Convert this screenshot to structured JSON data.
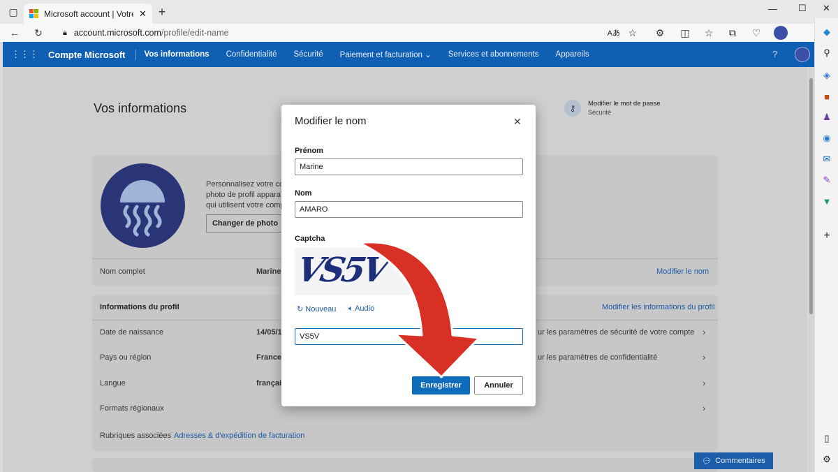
{
  "browser": {
    "tab_title": "Microsoft account | Votre profil",
    "url_host": "account.microsoft.com",
    "url_path": "/profile/edit-name"
  },
  "header": {
    "brand": "Compte Microsoft",
    "nav": [
      "Vos informations",
      "Confidentialité",
      "Sécurité",
      "Paiement et facturation",
      "Services et abonnements",
      "Appareils"
    ],
    "help": "?"
  },
  "page": {
    "title": "Vos informations",
    "password_link": "Modifier le mot de passe",
    "password_sub": "Sécurité",
    "photo_text_1": "Personnalisez votre com",
    "photo_text_2": "photo de profil apparaî",
    "photo_text_3": "qui utilisent votre comp",
    "change_photo": "Changer de photo",
    "fullname_label": "Nom complet",
    "fullname_value": "Marine",
    "edit_name": "Modifier le nom",
    "profile_info": "Informations du profil",
    "edit_profile": "Modifier les informations du profil",
    "dob_label": "Date de naissance",
    "dob_value": "14/05/1",
    "dob_link": "ur les paramètres de sécurité de votre compte",
    "country_label": "Pays ou région",
    "country_value": "France",
    "country_link": "ur les paramètres de confidentialité",
    "lang_label": "Langue",
    "lang_value": "françai",
    "formats_label": "Formats régionaux",
    "related_label": "Rubriques associées",
    "related_link": "Adresses & d'expédition de facturation",
    "feedback": "Commentaires"
  },
  "modal": {
    "title": "Modifier le nom",
    "first_label": "Prénom",
    "first_value": "Marine",
    "last_label": "Nom",
    "last_value": "AMARO",
    "captcha_label": "Captcha",
    "captcha_image_text": "VS5V",
    "new_link": "Nouveau",
    "audio_link": "Audio",
    "captcha_value": "VS5V",
    "save": "Enregistrer",
    "cancel": "Annuler"
  },
  "colors": {
    "accent": "#0f6cbd",
    "header": "#0f5fb5",
    "arrow": "#d93025"
  }
}
